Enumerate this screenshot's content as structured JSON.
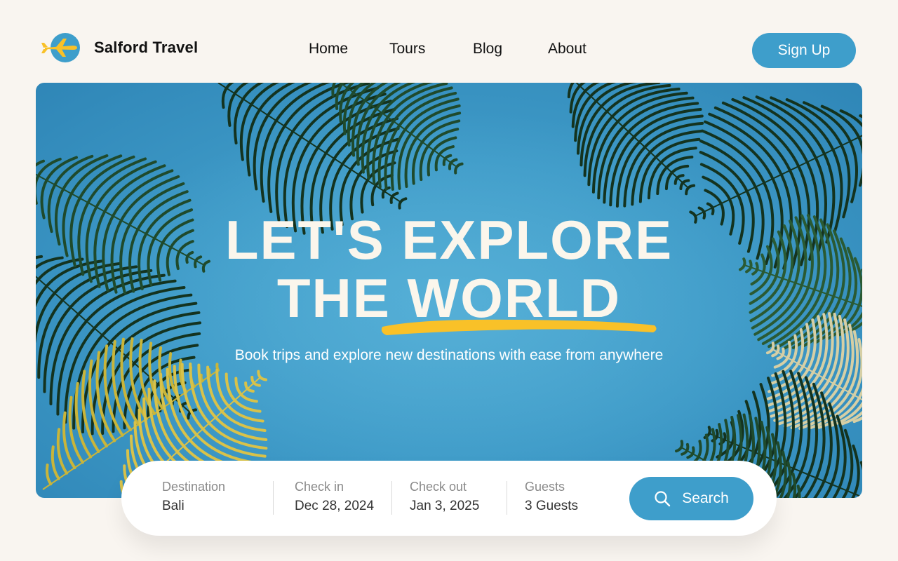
{
  "brand": {
    "name": "Salford Travel",
    "icon": "airplane-logo-icon"
  },
  "nav": {
    "items": [
      {
        "label": "Home"
      },
      {
        "label": "Tours"
      },
      {
        "label": "Blog"
      },
      {
        "label": "About"
      }
    ],
    "signup_label": "Sign Up"
  },
  "hero": {
    "headline_line1": "LET'S EXPLORE",
    "headline_line2": "THE WORLD",
    "subtitle": "Book trips and explore new destinations with ease from anywhere"
  },
  "search": {
    "fields": [
      {
        "label": "Destination",
        "value": "Bali"
      },
      {
        "label": "Check in",
        "value": "Dec 28, 2024"
      },
      {
        "label": "Check out",
        "value": "Jan 3, 2025"
      },
      {
        "label": "Guests",
        "value": "3 Guests"
      }
    ],
    "button_label": "Search",
    "button_icon": "search-icon"
  },
  "colors": {
    "accent": "#3e9ecb",
    "highlight": "#f9c128",
    "background": "#f9f5f0",
    "headline": "#fbf6ec"
  }
}
